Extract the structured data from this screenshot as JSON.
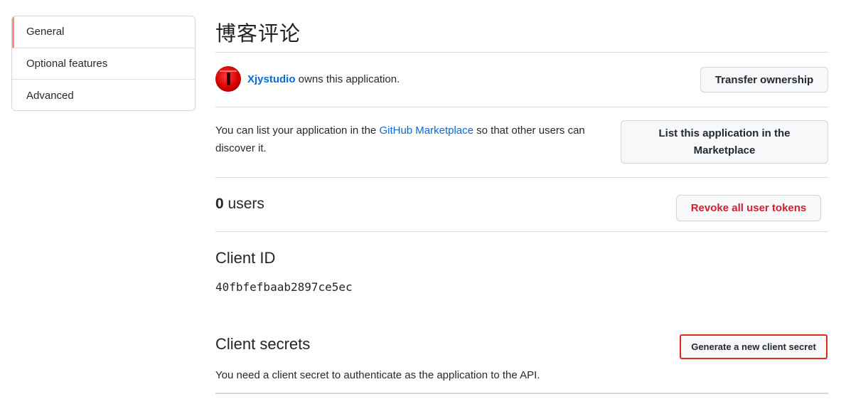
{
  "sidebar": {
    "items": [
      {
        "label": "General",
        "selected": true
      },
      {
        "label": "Optional features",
        "selected": false
      },
      {
        "label": "Advanced",
        "selected": false
      }
    ]
  },
  "page": {
    "title": "博客评论"
  },
  "owner": {
    "name": "Xjystudio",
    "suffix": " owns this application.",
    "transfer_label": "Transfer ownership"
  },
  "marketplace": {
    "text_before": "You can list your application in the ",
    "link_label": "GitHub Marketplace",
    "text_after": " so that other users can discover it.",
    "button_label": "List this application in the Marketplace"
  },
  "users": {
    "count": "0",
    "label": " users",
    "revoke_label": "Revoke all user tokens"
  },
  "client_id": {
    "heading": "Client ID",
    "value": "40fbfefbaab2897ce5ec"
  },
  "client_secrets": {
    "heading": "Client secrets",
    "generate_label": "Generate a new client secret",
    "description": "You need a client secret to authenticate as the application to the API."
  },
  "colors": {
    "accent_link": "#0969da",
    "danger": "#cf222e",
    "selected_indicator": "#fd8c73",
    "highlight_box": "#e5261f"
  }
}
